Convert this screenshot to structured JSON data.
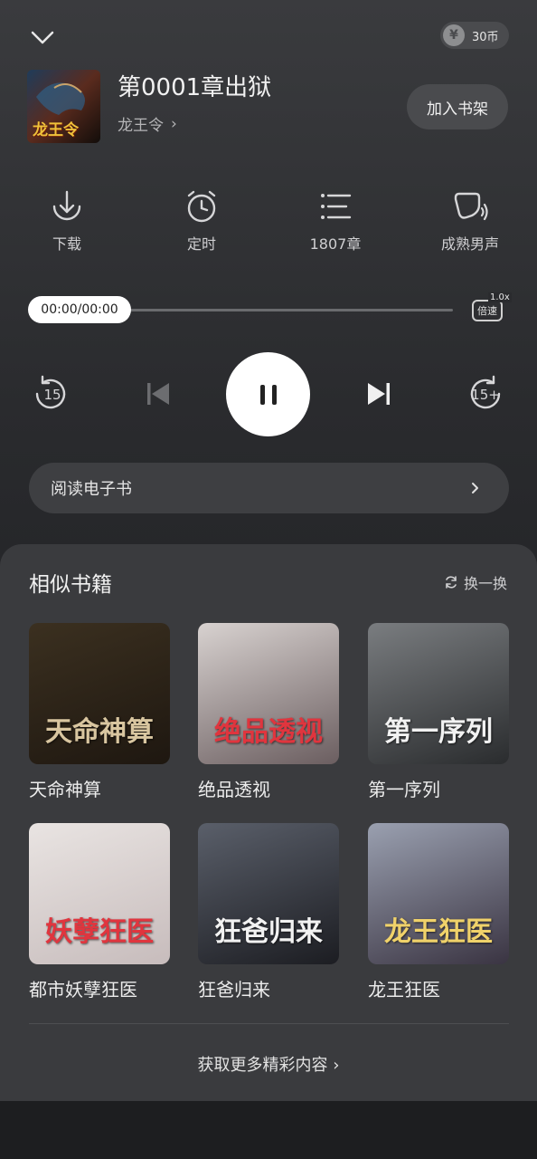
{
  "header": {
    "coins": "30币",
    "coin_symbol": "¥"
  },
  "book": {
    "chapter_title": "第0001章出狱",
    "author": "龙王令",
    "cover_text": "龙王令",
    "add_to_shelf": "加入书架"
  },
  "actions": [
    {
      "label": "下载",
      "icon": "download-icon"
    },
    {
      "label": "定时",
      "icon": "alarm-clock-icon"
    },
    {
      "label": "1807章",
      "icon": "chapter-list-icon"
    },
    {
      "label": "成熟男声",
      "icon": "voice-icon"
    }
  ],
  "player": {
    "time": "00:00/00:00",
    "progress": 0,
    "speed_label": "倍速",
    "speed_value": "1.0x",
    "rewind_label": "15",
    "forward_label": "15+",
    "state": "playing"
  },
  "ebook": {
    "label": "阅读电子书"
  },
  "similar": {
    "title": "相似书籍",
    "refresh": "换一换",
    "books": [
      {
        "name": "天命神算",
        "cover_text": "天命神算",
        "color1": "#3b3020",
        "color2": "#1e1710"
      },
      {
        "name": "绝品透视",
        "cover_text": "绝品透视",
        "color1": "#d8d2d0",
        "color2": "#6b5e60"
      },
      {
        "name": "第一序列",
        "cover_text": "第一序列",
        "color1": "#7a7d80",
        "color2": "#2a2c2e"
      },
      {
        "name": "都市妖孽狂医",
        "cover_text": "妖孽狂医",
        "color1": "#e9e4e2",
        "color2": "#c7bcbc"
      },
      {
        "name": "狂爸归来",
        "cover_text": "狂爸归来",
        "color1": "#5a5f6a",
        "color2": "#1c1d22"
      },
      {
        "name": "龙王狂医",
        "cover_text": "龙王狂医",
        "color1": "#9aa0b0",
        "color2": "#3a3442"
      }
    ],
    "more": "获取更多精彩内容"
  },
  "colors": {
    "background": "#222326",
    "panel": "#3a3b3e",
    "pill": "#4a4b4e",
    "accent_red": "#e0353e"
  }
}
